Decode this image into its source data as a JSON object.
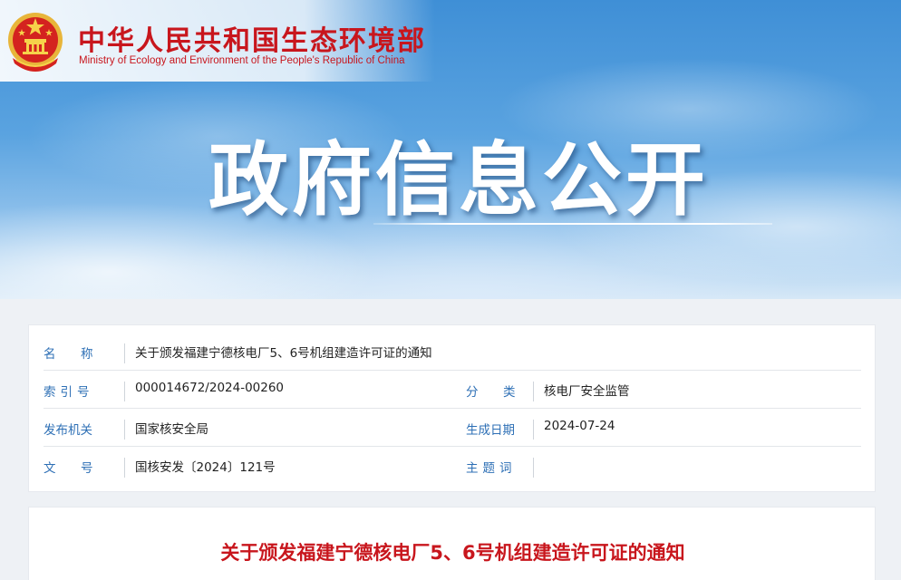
{
  "header": {
    "ministry_cn": "中华人民共和国生态环境部",
    "ministry_en": "Ministry of Ecology and Environment of the People's Republic of China",
    "hero_title": "政府信息公开",
    "emblem_icon": "national-emblem-icon"
  },
  "metadata": {
    "name_label": "名　称",
    "name_value": "关于颁发福建宁德核电厂5、6号机组建造许可证的通知",
    "index_label": "索引号",
    "index_value": "000014672/2024-00260",
    "category_label": "分　类",
    "category_value": "核电厂安全监管",
    "issuer_label": "发布机关",
    "issuer_value": "国家核安全局",
    "date_label": "生成日期",
    "date_value": "2024-07-24",
    "doc_no_label": "文　号",
    "doc_no_value": "国核安发〔2024〕121号",
    "subject_label": "主题词",
    "subject_value": ""
  },
  "article": {
    "title": "关于颁发福建宁德核电厂5、6号机组建造许可证的通知"
  },
  "colors": {
    "brand_red": "#c8161d",
    "label_blue": "#2d6fb5",
    "sky_blue": "#4a97da"
  }
}
